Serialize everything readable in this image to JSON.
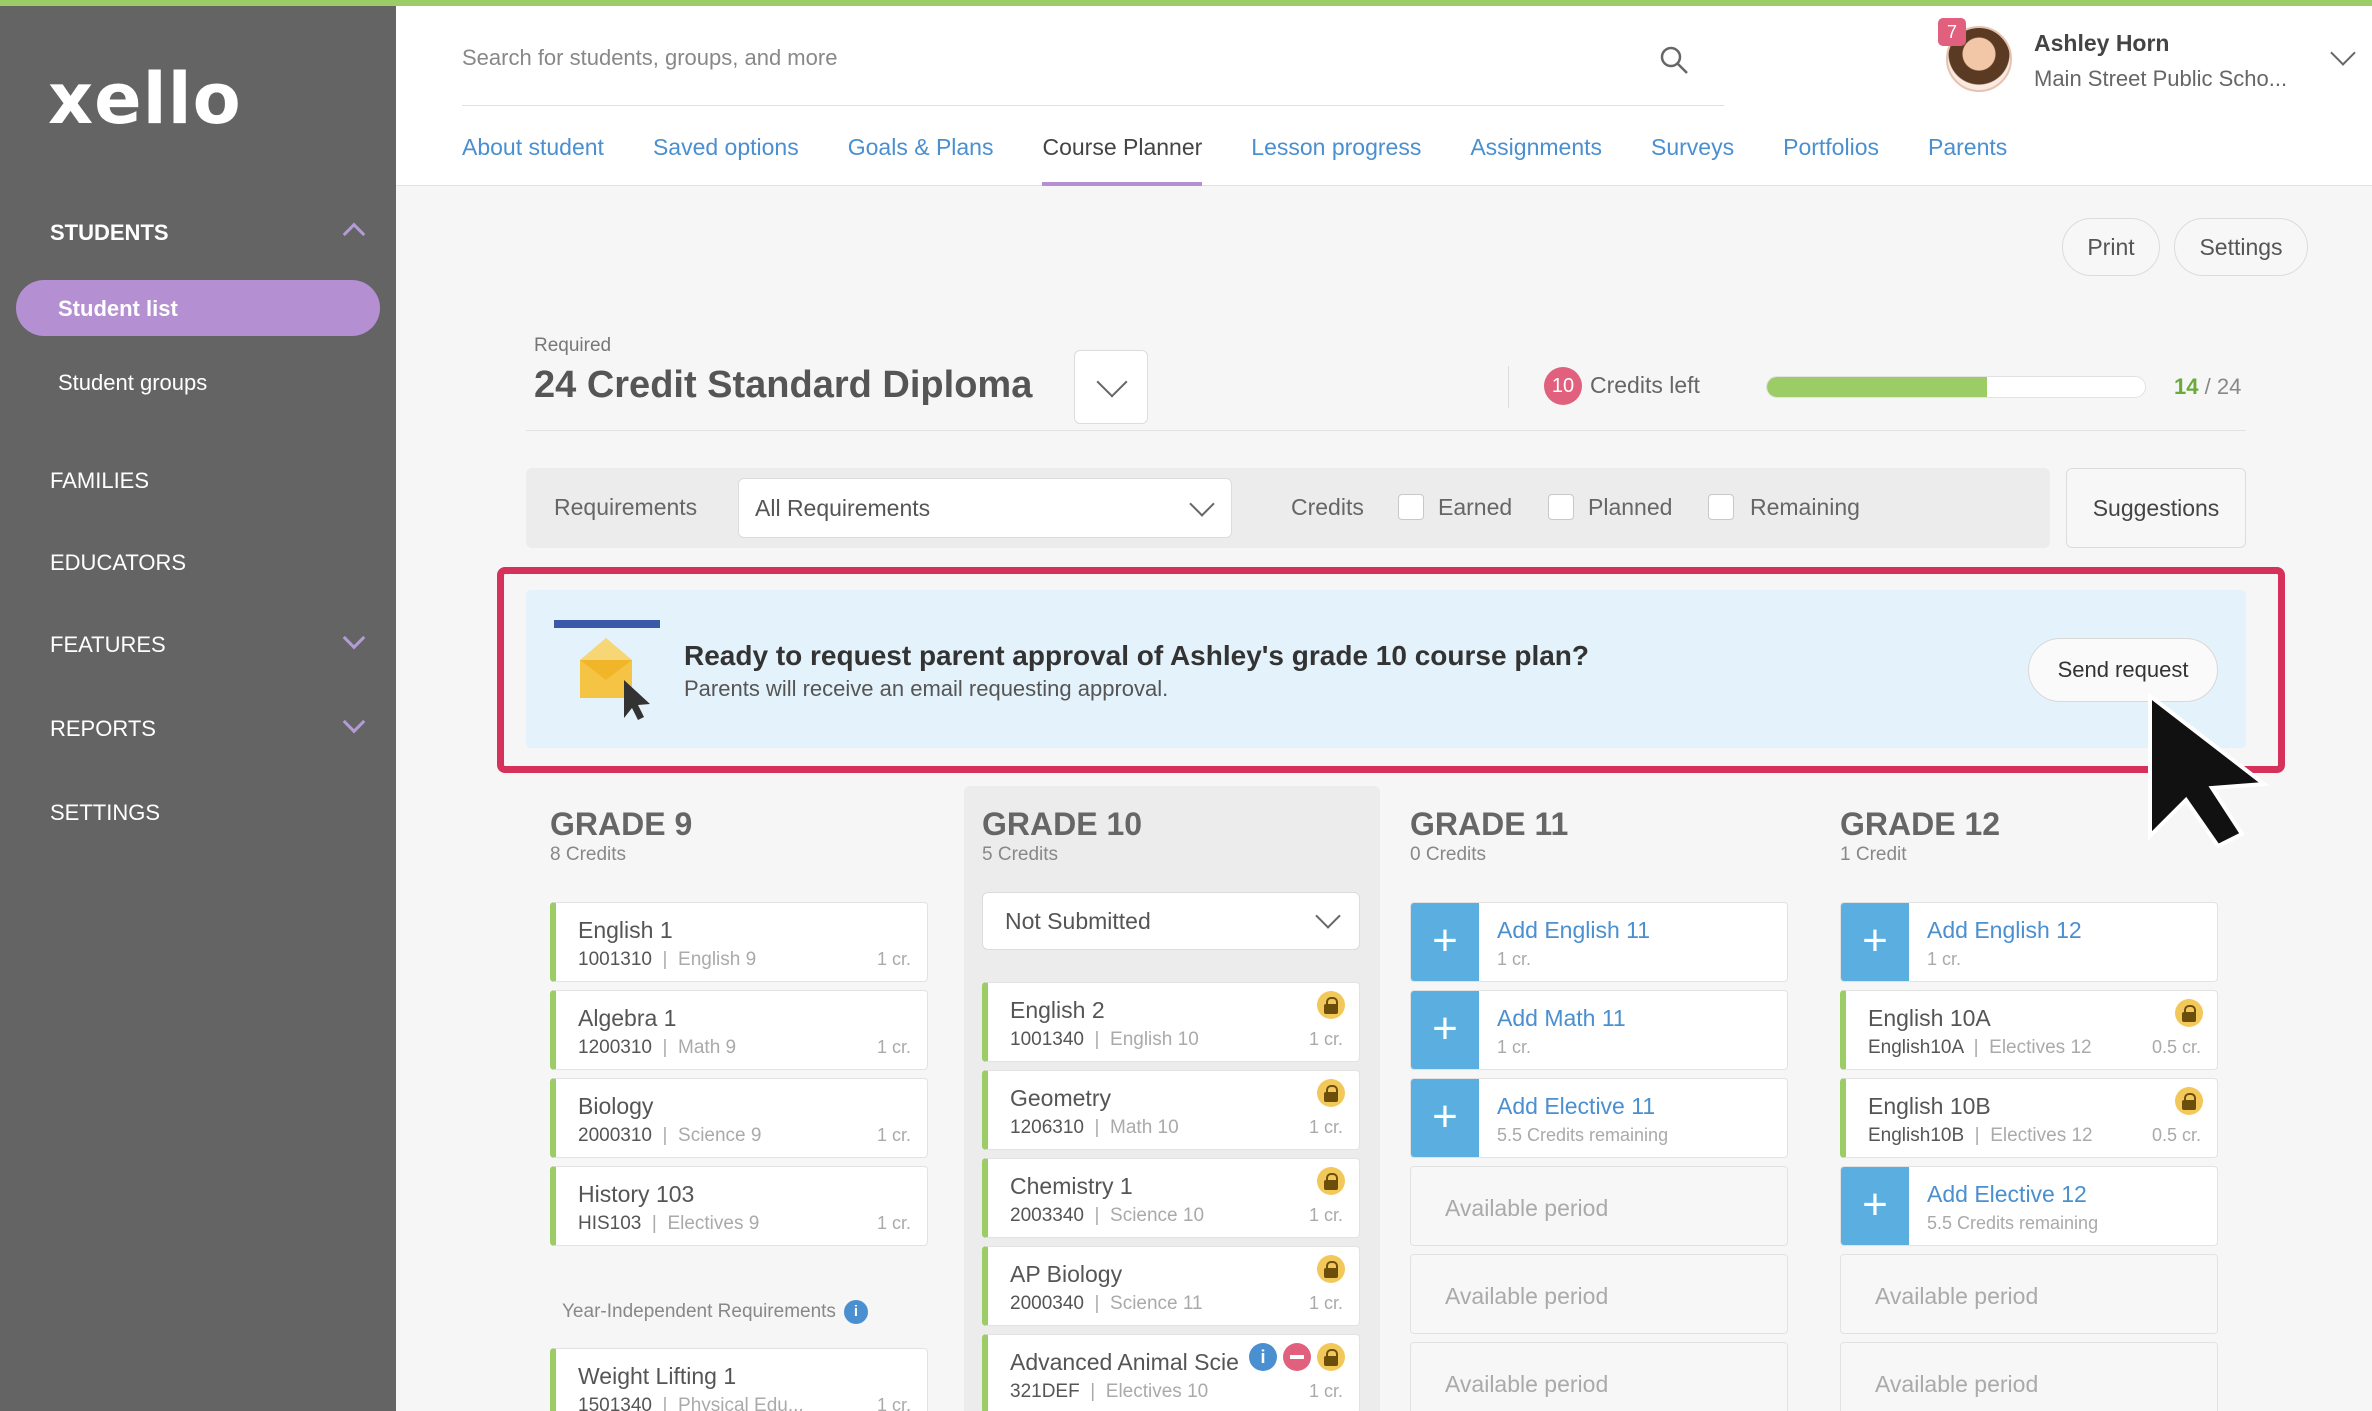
{
  "app": {
    "logo": "xello"
  },
  "sidebar": {
    "students_label": "STUDENTS",
    "student_list": "Student list",
    "student_groups": "Student groups",
    "families": "FAMILIES",
    "educators": "EDUCATORS",
    "features": "FEATURES",
    "reports": "REPORTS",
    "settings": "SETTINGS"
  },
  "header": {
    "search_placeholder": "Search for students, groups, and more",
    "tabs": [
      "About student",
      "Saved options",
      "Goals & Plans",
      "Course Planner",
      "Lesson progress",
      "Assignments",
      "Surveys",
      "Portfolios",
      "Parents"
    ],
    "active_tab": "Course Planner",
    "user": {
      "name": "Ashley Horn",
      "school": "Main Street Public Scho...",
      "notification_count": "7"
    }
  },
  "toolbar": {
    "print": "Print",
    "settings": "Settings"
  },
  "diploma": {
    "required_label": "Required",
    "name": "24 Credit Standard Diploma",
    "credits_left_count": "10",
    "credits_left_label": "Credits left",
    "earned": "14",
    "total": "24",
    "progress_fraction": 0.583
  },
  "filters": {
    "requirements_label": "Requirements",
    "requirements_value": "All Requirements",
    "credits_label": "Credits",
    "earned": "Earned",
    "planned": "Planned",
    "remaining": "Remaining",
    "suggestions": "Suggestions"
  },
  "banner": {
    "title": "Ready to request parent approval of Ashley's grade 10 course plan?",
    "subtitle": "Parents will receive an email requesting approval.",
    "button": "Send request"
  },
  "grades": {
    "g9": {
      "title": "GRADE 9",
      "credits": "8 Credits",
      "courses": [
        {
          "title": "English 1",
          "code": "1001310",
          "subject": "English 9",
          "cr": "1 cr."
        },
        {
          "title": "Algebra 1",
          "code": "1200310",
          "subject": "Math 9",
          "cr": "1 cr."
        },
        {
          "title": "Biology",
          "code": "2000310",
          "subject": "Science 9",
          "cr": "1 cr."
        },
        {
          "title": "History 103",
          "code": "HIS103",
          "subject": "Electives 9",
          "cr": "1 cr."
        }
      ],
      "year_independent": "Year-Independent Requirements",
      "yi_course": {
        "title": "Weight Lifting 1",
        "code": "1501340",
        "subject": "Physical Edu...",
        "cr": "1 cr."
      }
    },
    "g10": {
      "title": "GRADE 10",
      "credits": "5 Credits",
      "status": "Not Submitted",
      "courses": [
        {
          "title": "English 2",
          "code": "1001340",
          "subject": "English 10",
          "cr": "1 cr."
        },
        {
          "title": "Geometry",
          "code": "1206310",
          "subject": "Math 10",
          "cr": "1 cr."
        },
        {
          "title": "Chemistry 1",
          "code": "2003340",
          "subject": "Science 10",
          "cr": "1 cr."
        },
        {
          "title": "AP Biology",
          "code": "2000340",
          "subject": "Science 11",
          "cr": "1 cr."
        },
        {
          "title": "Advanced Animal Scie",
          "code": "321DEF",
          "subject": "Electives 10",
          "cr": "1 cr."
        }
      ]
    },
    "g11": {
      "title": "GRADE 11",
      "credits": "0 Credits",
      "adds": [
        {
          "title": "Add English 11",
          "sub": "1 cr."
        },
        {
          "title": "Add Math 11",
          "sub": "1 cr."
        },
        {
          "title": "Add Elective 11",
          "sub": "5.5 Credits remaining"
        }
      ],
      "available": "Available period"
    },
    "g12": {
      "title": "GRADE 12",
      "credits": "1 Credit",
      "add_english": {
        "title": "Add English 12",
        "sub": "1 cr."
      },
      "courses": [
        {
          "title": "English 10A",
          "code": "English10A",
          "subject": "Electives 12",
          "cr": "0.5 cr."
        },
        {
          "title": "English 10B",
          "code": "English10B",
          "subject": "Electives 12",
          "cr": "0.5 cr."
        }
      ],
      "add_elective": {
        "title": "Add Elective 12",
        "sub": "5.5 Credits remaining"
      },
      "available": "Available period"
    }
  },
  "colors": {
    "accent": "#b48fd1",
    "link": "#4a8fd0",
    "green": "#9ccc65",
    "highlight": "#d6315a",
    "alert": "#e0607d"
  }
}
